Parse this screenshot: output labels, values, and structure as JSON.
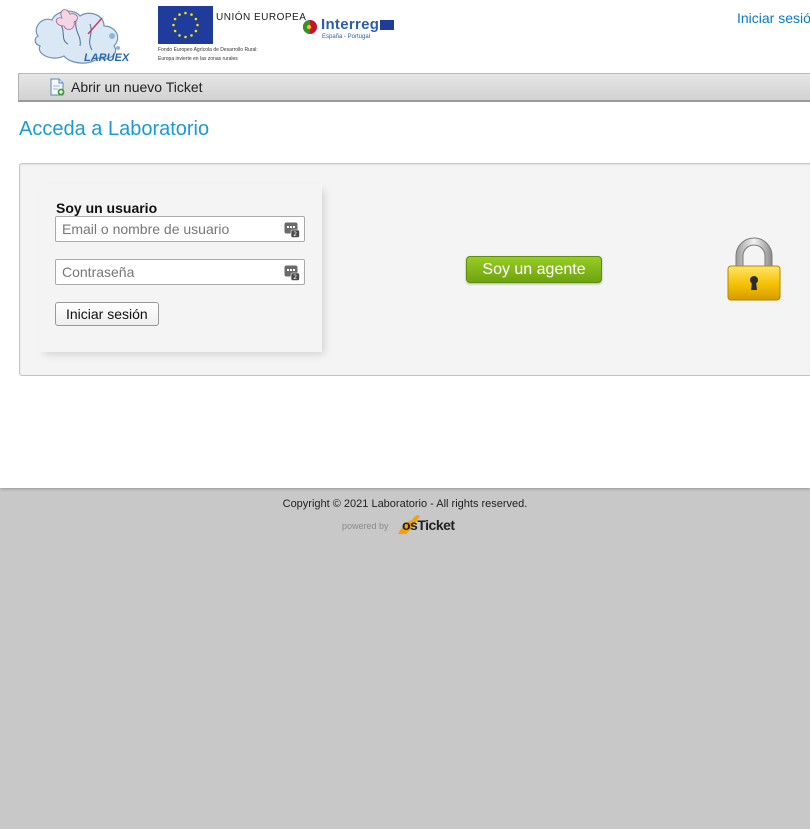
{
  "header": {
    "laruex_logo_text": "LARUEX",
    "eu_title": "UNIÓN EUROPEA",
    "eu_sub1": "Fondo Europeo Agrícola de Desarrollo Rural:",
    "eu_sub2": "Europa invierte en las zonas rurales",
    "interreg_name": "Interreg",
    "interreg_sub": "España - Portugal",
    "signin_link": "Iniciar sesión"
  },
  "nav": {
    "new_ticket": "Abrir un nuevo Ticket",
    "new_ticket_icon": "new-ticket-icon"
  },
  "main": {
    "title": "Acceda a Laboratorio"
  },
  "login": {
    "user_heading": "Soy un usuario",
    "email_placeholder": "Email o nombre de usuario",
    "email_value": "",
    "password_placeholder": "Contraseña",
    "password_value": "",
    "signin_button": "Iniciar sesión",
    "agent_button": "Soy un agente"
  },
  "footer": {
    "copyright": "Copyright © 2021 Laboratorio - All rights reserved.",
    "powered_by": "powered by",
    "osticket": "osTicket"
  },
  "colors": {
    "accent": "#1a9ad6",
    "link": "#0a7ac8",
    "agent_button": "#7cb518",
    "footer_bg": "#c8c8c8"
  }
}
